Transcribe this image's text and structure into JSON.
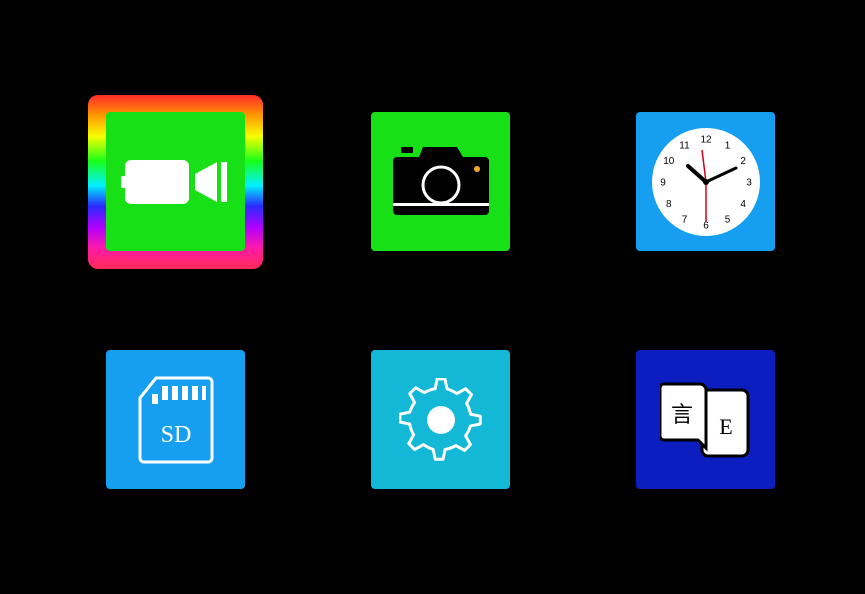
{
  "menu": {
    "selected_index": 0,
    "tiles": [
      {
        "id": "video",
        "icon": "video-camera-icon",
        "bg": "#17e017"
      },
      {
        "id": "photo",
        "icon": "photo-camera-icon",
        "bg": "#17e017"
      },
      {
        "id": "clock",
        "icon": "clock-icon",
        "bg": "#169ff0"
      },
      {
        "id": "sd_card",
        "icon": "sd-card-icon",
        "bg": "#169ff0",
        "text": "SD"
      },
      {
        "id": "settings",
        "icon": "gear-icon",
        "bg": "#12b8d6"
      },
      {
        "id": "language",
        "icon": "language-icon",
        "bg": "#0c1ec0",
        "text_left": "言",
        "text_right": "E"
      }
    ],
    "clock_face": {
      "numerals": [
        "12",
        "1",
        "2",
        "3",
        "4",
        "5",
        "6",
        "7",
        "8",
        "9",
        "10",
        "11"
      ]
    },
    "selection_ring": "rainbow-gradient"
  }
}
